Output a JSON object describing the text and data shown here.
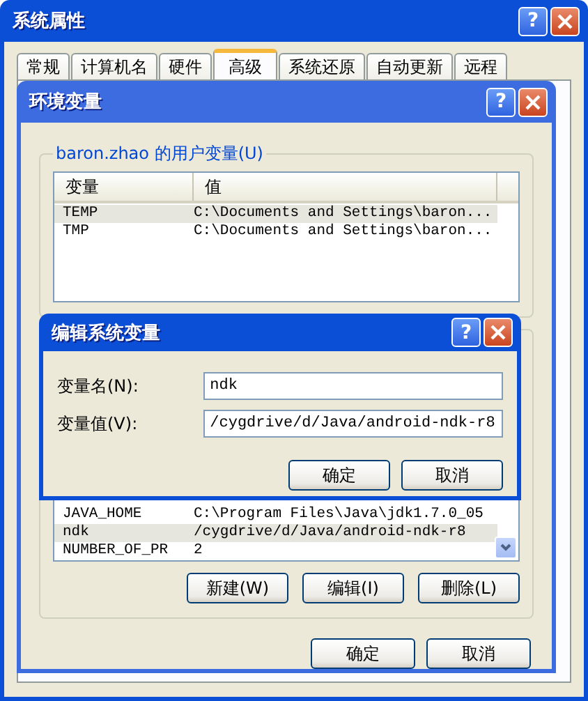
{
  "window": {
    "title": "系统属性",
    "help": "?"
  },
  "tabs": [
    {
      "label": "常规",
      "selected": false
    },
    {
      "label": "计算机名",
      "selected": false
    },
    {
      "label": "硬件",
      "selected": false
    },
    {
      "label": "高级",
      "selected": true
    },
    {
      "label": "系统还原",
      "selected": false
    },
    {
      "label": "自动更新",
      "selected": false
    },
    {
      "label": "远程",
      "selected": false
    }
  ],
  "env_dialog": {
    "title": "环境变量",
    "help": "?",
    "user_group": {
      "label": "baron.zhao 的用户变量(U)",
      "columns": [
        "变量",
        "值"
      ],
      "rows": [
        {
          "name": "TEMP",
          "value": "C:\\Documents and Settings\\baron...",
          "selected": true
        },
        {
          "name": "TMP",
          "value": "C:\\Documents and Settings\\baron...",
          "selected": false
        }
      ]
    },
    "system_group": {
      "rows": [
        {
          "name": "JAVA_HOME",
          "value": "C:\\Program Files\\Java\\jdk1.7.0_05",
          "selected": false
        },
        {
          "name": "ndk",
          "value": "/cygdrive/d/Java/android-ndk-r8",
          "selected": true
        },
        {
          "name": "NUMBER_OF_PR",
          "value": "2",
          "selected": false
        }
      ],
      "buttons": [
        "新建(W)",
        "编辑(I)",
        "删除(L)"
      ]
    },
    "buttons": [
      "确定",
      "取消"
    ]
  },
  "edit_dialog": {
    "title": "编辑系统变量",
    "help": "?",
    "fields": [
      {
        "label": "变量名(N):",
        "value": "ndk"
      },
      {
        "label": "变量值(V):",
        "value": "/cygdrive/d/Java/android-ndk-r8"
      }
    ],
    "buttons": [
      "确定",
      "取消"
    ]
  }
}
